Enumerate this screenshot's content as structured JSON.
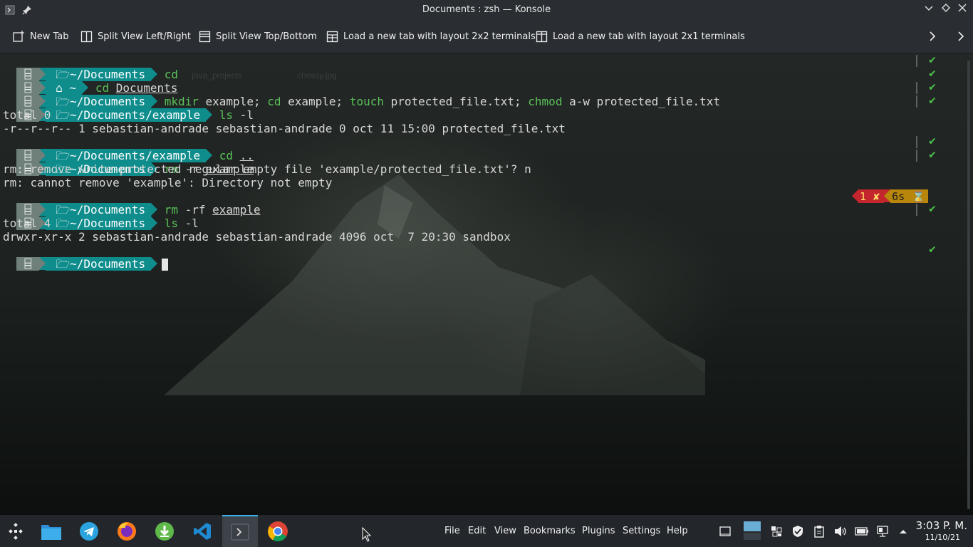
{
  "window": {
    "title": "Documents : zsh — Konsole"
  },
  "toolbar": {
    "new_tab": "New Tab",
    "split_lr": "Split View Left/Right",
    "split_tb": "Split View Top/Bottom",
    "layout_2x2": "Load a new tab with layout 2x2 terminals",
    "layout_2x1": "Load a new tab with layout 2x1 terminals"
  },
  "terminal": {
    "ghost_1": "java_projects",
    "ghost_2": "chrissy.jpg",
    "l1": {
      "path": "~/Documents",
      "cmd": "cd"
    },
    "l2": {
      "path": "~",
      "cmd": "cd",
      "arg": "Documents"
    },
    "l3": {
      "path": "~/Documents",
      "c1": "mkdir",
      "a1": " example; ",
      "c2": "cd",
      "a2": " example; ",
      "c3": "touch",
      "a3": " protected_file.txt; ",
      "c4": "chmod",
      "a4": " a-w protected_file.txt"
    },
    "l4": {
      "path": "~/Documents/example",
      "cmd": "ls",
      "arg": " -l"
    },
    "o1": "total 0",
    "o2": "-r--r--r-- 1 sebastian-andrade sebastian-andrade 0 oct 11 15:00 protected_file.txt",
    "l5": {
      "path": "~/Documents/example",
      "cmd": "cd",
      "arg": ".."
    },
    "l6": {
      "path": "~/Documents",
      "cmd": "rm",
      "flag": " -r ",
      "arg": "example"
    },
    "o3": "rm: remove write-protected regular empty file 'example/protected_file.txt'? n",
    "o4": "rm: cannot remove 'example': Directory not empty",
    "l7": {
      "path": "~/Documents",
      "cmd": "rm",
      "flag": " -rf ",
      "arg": "example"
    },
    "l8": {
      "path": "~/Documents",
      "cmd": "ls",
      "arg": " -l"
    },
    "o5": "total 4",
    "o6": "drwxr-xr-x 2 sebastian-andrade sebastian-andrade 4096 oct  7 20:30 sandbox",
    "l9": {
      "path": "~/Documents"
    },
    "check": "✔",
    "err_code": "1",
    "err_mark": "✘",
    "duration": "6s",
    "hourglass": "⌛"
  },
  "taskbar": {
    "menu": [
      "File",
      "Edit",
      "View",
      "Bookmarks",
      "Plugins",
      "Settings",
      "Help"
    ],
    "time": "3:03 P. M.",
    "date": "11/10/21"
  }
}
